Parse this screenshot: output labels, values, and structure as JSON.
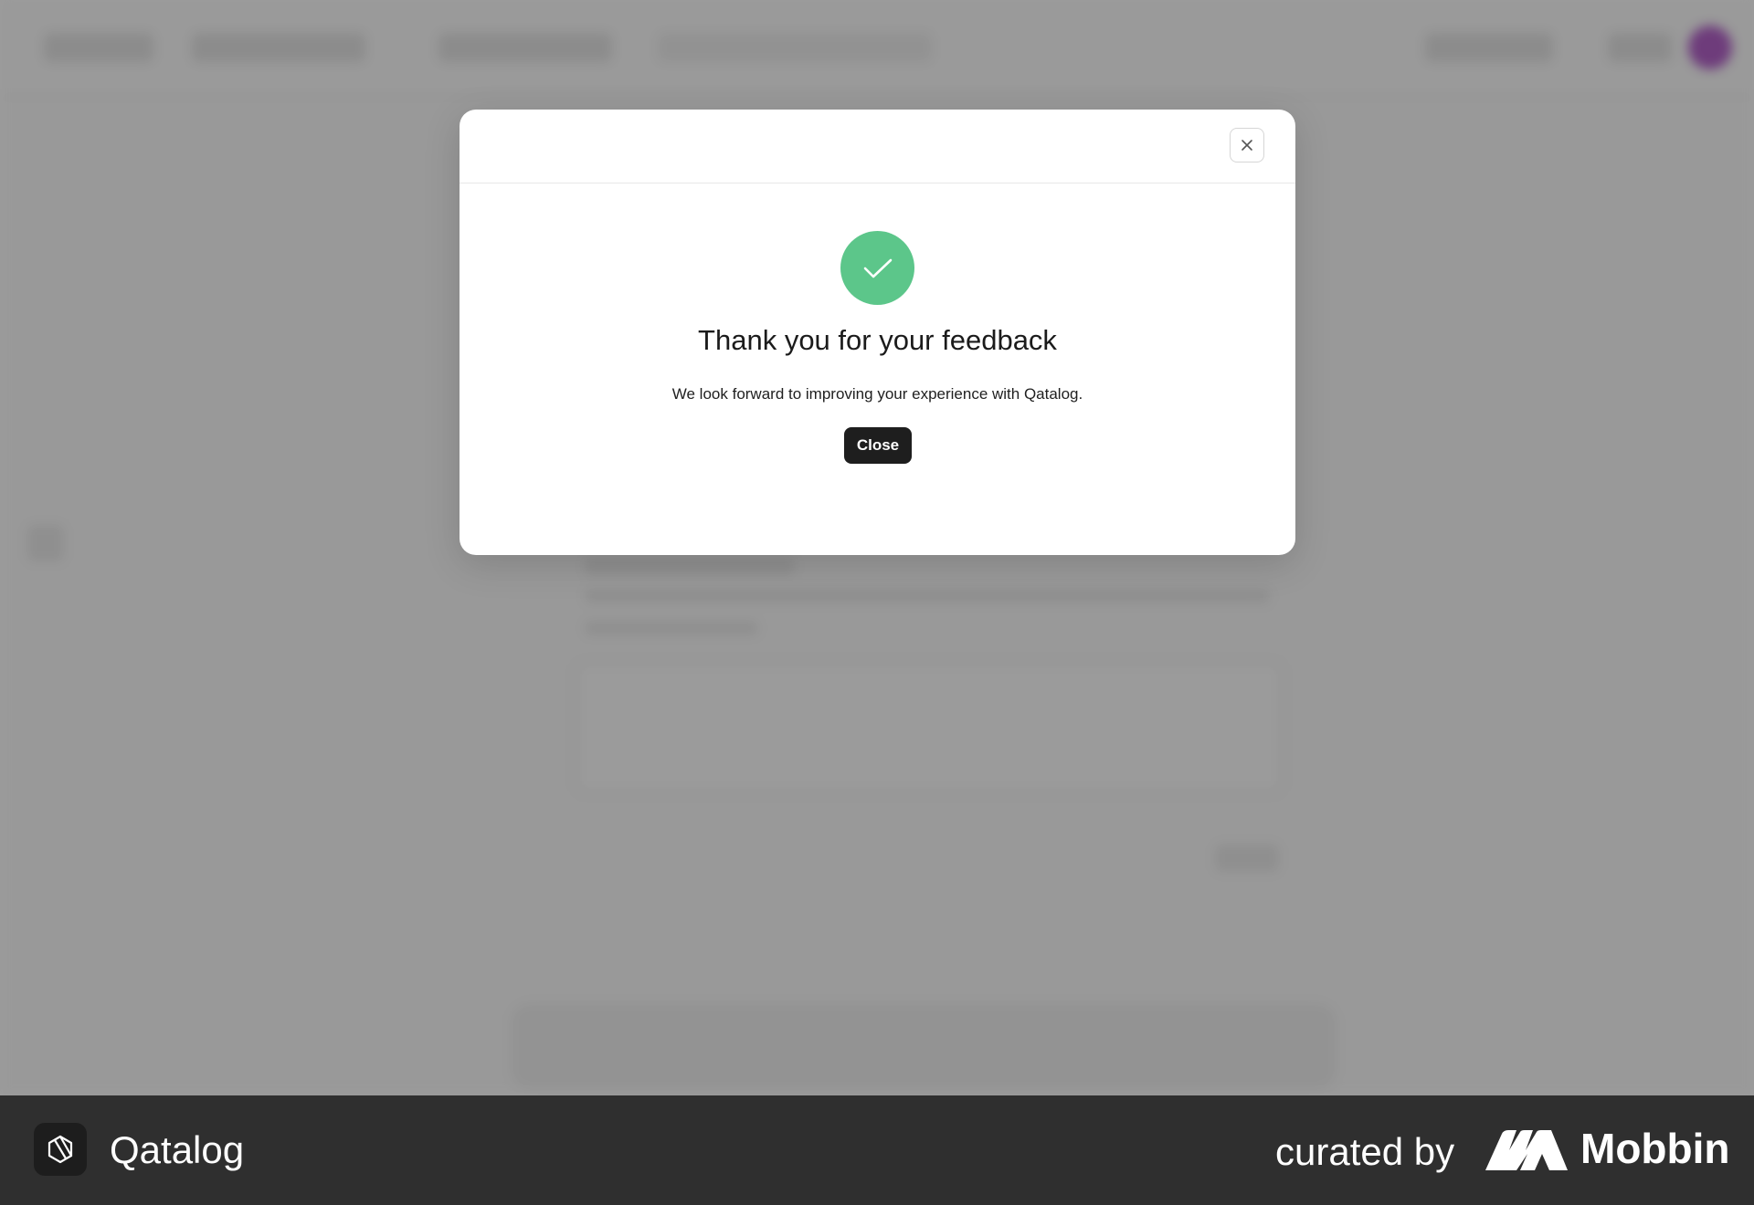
{
  "modal": {
    "title": "Thank you for your feedback",
    "message": "We look forward to improving your experience with Qatalog.",
    "close_button_label": "Close",
    "close_icon": "close-icon",
    "status_icon": "checkmark-icon",
    "status_color": "#5cc68a"
  },
  "footer": {
    "app_name": "Qatalog",
    "app_logo_icon": "qatalog-logo-icon",
    "curated_by_label": "curated by",
    "brand_name": "Mobbin",
    "brand_logo_icon": "mobbin-logo-icon"
  },
  "colors": {
    "overlay": "rgba(20,20,20,0.42)",
    "button_bg": "#1e1e1e",
    "footer_bg": "#2f2f2f",
    "avatar": "#b05ac7"
  }
}
